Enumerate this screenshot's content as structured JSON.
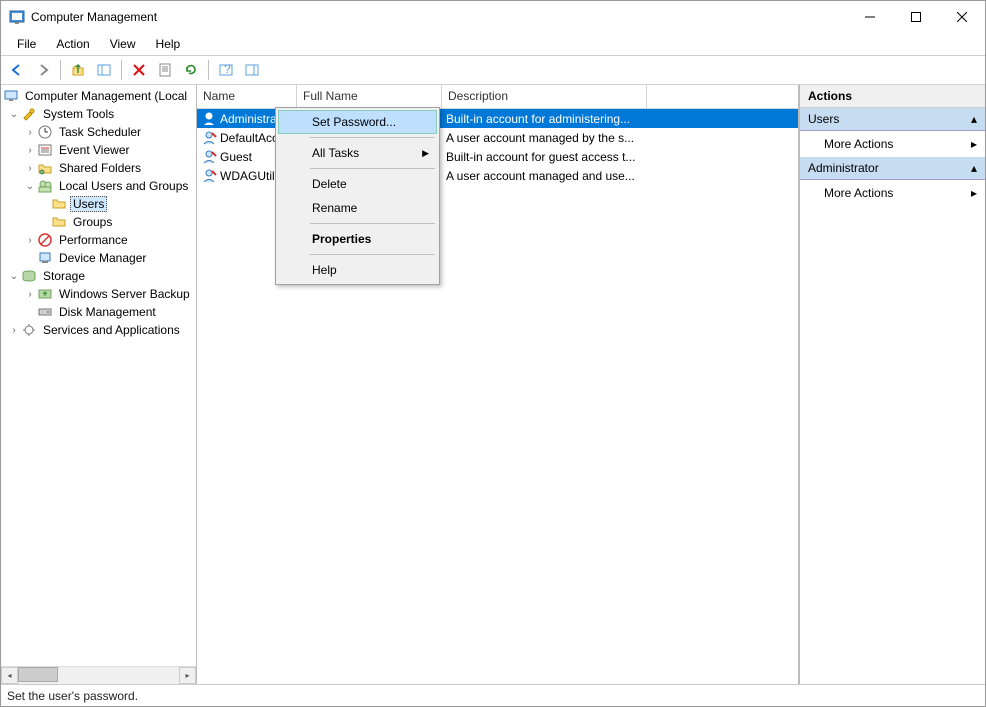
{
  "window": {
    "title": "Computer Management"
  },
  "menu": {
    "file": "File",
    "action": "Action",
    "view": "View",
    "help": "Help"
  },
  "tree": {
    "root": "Computer Management (Local",
    "system_tools": "System Tools",
    "task_scheduler": "Task Scheduler",
    "event_viewer": "Event Viewer",
    "shared_folders": "Shared Folders",
    "local_users": "Local Users and Groups",
    "users": "Users",
    "groups": "Groups",
    "performance": "Performance",
    "device_manager": "Device Manager",
    "storage": "Storage",
    "wsb": "Windows Server Backup",
    "disk_mgmt": "Disk Management",
    "services_apps": "Services and Applications"
  },
  "columns": {
    "name": "Name",
    "full": "Full Name",
    "desc": "Description"
  },
  "users": [
    {
      "name": "Administrator",
      "full": "",
      "desc": "Built-in account for administering..."
    },
    {
      "name": "DefaultAcc...",
      "full": "",
      "desc": "A user account managed by the s..."
    },
    {
      "name": "Guest",
      "full": "",
      "desc": "Built-in account for guest access t..."
    },
    {
      "name": "WDAGUtilit...",
      "full": "",
      "desc": "A user account managed and use..."
    }
  ],
  "context_menu": {
    "set_password": "Set Password...",
    "all_tasks": "All Tasks",
    "delete": "Delete",
    "rename": "Rename",
    "properties": "Properties",
    "help": "Help"
  },
  "actions": {
    "header": "Actions",
    "users_section": "Users",
    "admin_section": "Administrator",
    "more": "More Actions"
  },
  "status": "Set the user's password."
}
